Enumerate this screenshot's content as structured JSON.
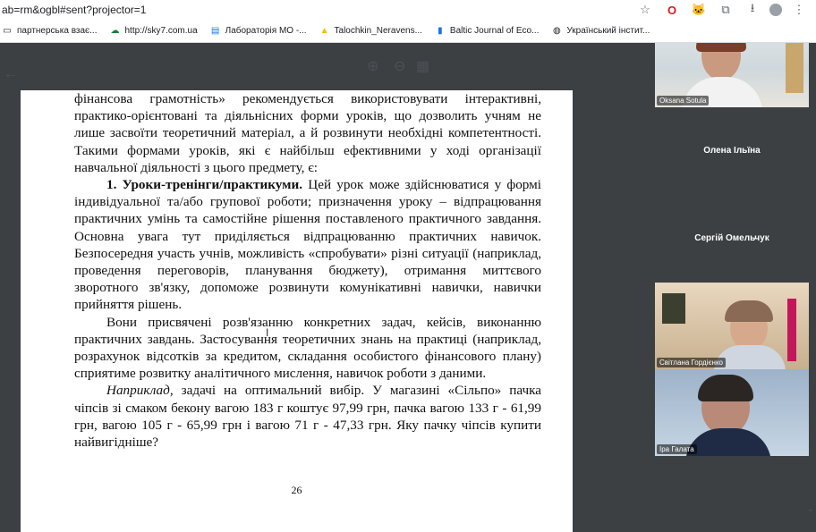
{
  "browser": {
    "url": "ab=rm&ogbl#sent?projector=1",
    "bookmarks": [
      {
        "label": "партнерська взає...",
        "icon": "folder-icon"
      },
      {
        "label": "http://sky7.com.ua",
        "icon": "cloud-icon"
      },
      {
        "label": "Лабораторія МО -...",
        "icon": "doc-icon"
      },
      {
        "label": "Talochkin_Neravens...",
        "icon": "drive-icon"
      },
      {
        "label": "Baltic Journal of Eco...",
        "icon": "file-icon"
      },
      {
        "label": "Український інстит...",
        "icon": "globe-icon"
      }
    ]
  },
  "document": {
    "p0": "фінансова грамотність» рекомендується використовувати інтерактивні, практико-орієнтовані та діяльнісних форми уроків, що дозволить учням не лише засвоїти теоретичний матеріал, а й розвинути необхідні компетентності. Такими формами уроків, які є найбільш ефективними у ході організації навчальної діяльності з цього предмету, є:",
    "p1_bold": "1. Уроки-тренінги/практикуми.",
    "p1_rest": " Цей урок може здійснюватися у формі індивідуальної та/або групової роботи; призначення уроку – відпрацювання практичних умінь та самостійне рішення поставленого практичного завдання. Основна увага тут приділяється відпрацюванню практичних навичок. Безпосередня участь учнів, можливість «спробувати» різні ситуації (наприклад, проведення переговорів, планування бюджету), отримання миттєвого зворотного зв'язку, допоможе розвинути комунікативні навички, навички прийняття рішень.",
    "p2": "Вони присвячені розв'язанню конкретних задач, кейсів, виконанню практичних завдань. Застосування теоретичних знань на практиці (наприклад, розрахунок відсотків за кредитом, складання особистого фінансового плану) сприятиме розвитку аналітичного мислення, навичок роботи з даними.",
    "p3_italic": "Наприклад",
    "p3_rest": ", задачі на оптимальний вибір. У магазині «Сільпо» пачка чіпсів зі смаком бекону вагою 183 г коштує 97,99 грн, пачка вагою 133 г - 61,99 грн, вагою 105 г - 65,99 грн і вагою 71 г - 47,33 грн. Яку пачку чіпсів купити найвигідніше?",
    "page_number": "26"
  },
  "participants": [
    {
      "name": "Oksana Sotula",
      "video": true
    },
    {
      "name": "Олена Ільїна",
      "video": false
    },
    {
      "name": "Сергій Омельчук",
      "video": false
    },
    {
      "name": "Світлана Гордієнко",
      "video": true
    },
    {
      "name": "Іра Галата",
      "video": true
    }
  ],
  "colors": {
    "accent": "#1a73e8",
    "tile_bg": "#3c4043"
  }
}
